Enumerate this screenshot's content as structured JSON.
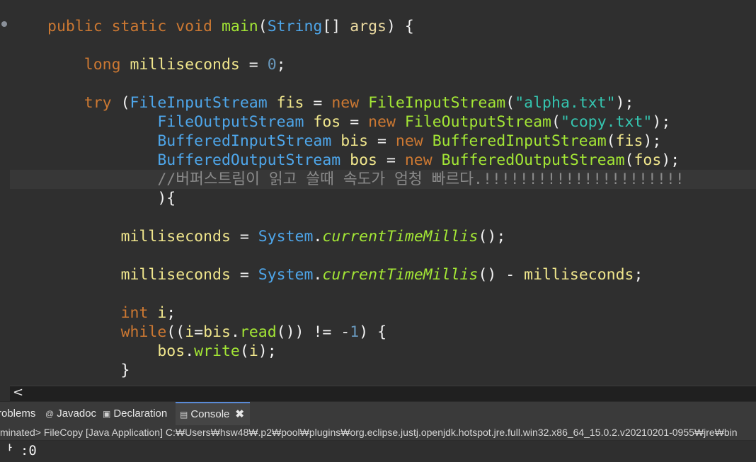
{
  "editor": {
    "lines": [
      [
        [
          "kw",
          "public "
        ],
        [
          "kw",
          "static "
        ],
        [
          "kw",
          "void "
        ],
        [
          "fn",
          "main"
        ],
        [
          "pl",
          "("
        ],
        [
          "ty",
          "String"
        ],
        [
          "pl",
          "[] "
        ],
        [
          "pa",
          "args"
        ],
        [
          "pl",
          ") {"
        ]
      ],
      [],
      [
        [
          "pl",
          "    "
        ],
        [
          "kw",
          "long "
        ],
        [
          "va",
          "milliseconds"
        ],
        [
          "pl",
          " = "
        ],
        [
          "nu",
          "0"
        ],
        [
          "pl",
          ";"
        ]
      ],
      [],
      [
        [
          "pl",
          "    "
        ],
        [
          "kw",
          "try "
        ],
        [
          "pl",
          "("
        ],
        [
          "ty",
          "FileInputStream "
        ],
        [
          "va",
          "fis"
        ],
        [
          "pl",
          " = "
        ],
        [
          "kw",
          "new "
        ],
        [
          "fn",
          "FileInputStream"
        ],
        [
          "pl",
          "("
        ],
        [
          "st",
          "\"alpha.txt\""
        ],
        [
          "pl",
          ");"
        ]
      ],
      [
        [
          "pl",
          "            "
        ],
        [
          "ty",
          "FileOutputStream "
        ],
        [
          "va",
          "fos"
        ],
        [
          "pl",
          " = "
        ],
        [
          "kw",
          "new "
        ],
        [
          "fn",
          "FileOutputStream"
        ],
        [
          "pl",
          "("
        ],
        [
          "st",
          "\"copy.txt\""
        ],
        [
          "pl",
          ");"
        ]
      ],
      [
        [
          "pl",
          "            "
        ],
        [
          "ty",
          "BufferedInputStream "
        ],
        [
          "va",
          "bis"
        ],
        [
          "pl",
          " = "
        ],
        [
          "kw",
          "new "
        ],
        [
          "fn",
          "BufferedInputStream"
        ],
        [
          "pl",
          "("
        ],
        [
          "va",
          "fis"
        ],
        [
          "pl",
          ");"
        ]
      ],
      [
        [
          "pl",
          "            "
        ],
        [
          "ty",
          "BufferedOutputStream "
        ],
        [
          "va",
          "bos"
        ],
        [
          "pl",
          " = "
        ],
        [
          "kw",
          "new "
        ],
        [
          "fn",
          "BufferedOutputStream"
        ],
        [
          "pl",
          "("
        ],
        [
          "va",
          "fos"
        ],
        [
          "pl",
          ");"
        ]
      ],
      [
        [
          "pl",
          "            "
        ],
        [
          "co",
          "//버퍼스트림이 읽고 쓸때 속도가 엄청 빠르다.!!!!!!!!!!!!!!!!!!!!!!"
        ]
      ],
      [
        [
          "pl",
          "            ){"
        ]
      ],
      [],
      [
        [
          "pl",
          "        "
        ],
        [
          "va",
          "milliseconds"
        ],
        [
          "pl",
          " = "
        ],
        [
          "ty",
          "System"
        ],
        [
          "pl",
          "."
        ],
        [
          "it",
          "currentTimeMillis"
        ],
        [
          "pl",
          "();"
        ]
      ],
      [],
      [
        [
          "pl",
          "        "
        ],
        [
          "va",
          "milliseconds"
        ],
        [
          "pl",
          " = "
        ],
        [
          "ty",
          "System"
        ],
        [
          "pl",
          "."
        ],
        [
          "it",
          "currentTimeMillis"
        ],
        [
          "pl",
          "() - "
        ],
        [
          "va",
          "milliseconds"
        ],
        [
          "pl",
          ";"
        ]
      ],
      [],
      [
        [
          "pl",
          "        "
        ],
        [
          "kw",
          "int "
        ],
        [
          "va",
          "i"
        ],
        [
          "pl",
          ";"
        ]
      ],
      [
        [
          "pl",
          "        "
        ],
        [
          "kw",
          "while"
        ],
        [
          "pl",
          "(("
        ],
        [
          "va",
          "i"
        ],
        [
          "pl",
          "="
        ],
        [
          "va",
          "bis"
        ],
        [
          "pl",
          "."
        ],
        [
          "me",
          "read"
        ],
        [
          "pl",
          "()) != -"
        ],
        [
          "nu",
          "1"
        ],
        [
          "pl",
          ") {"
        ]
      ],
      [
        [
          "pl",
          "            "
        ],
        [
          "va",
          "bos"
        ],
        [
          "pl",
          "."
        ],
        [
          "me",
          "write"
        ],
        [
          "pl",
          "("
        ],
        [
          "va",
          "i"
        ],
        [
          "pl",
          ");"
        ]
      ],
      [
        [
          "pl",
          "        }"
        ]
      ]
    ]
  },
  "scrollbar": {
    "left_arrow": "<"
  },
  "tabs": [
    {
      "label": "roblems",
      "icon": "problems-icon",
      "glyph": ""
    },
    {
      "label": "Javadoc",
      "icon": "javadoc-icon",
      "glyph": "@"
    },
    {
      "label": "Declaration",
      "icon": "declaration-icon",
      "glyph": "▣"
    },
    {
      "label": "Console",
      "icon": "console-icon",
      "glyph": "▤",
      "active": true,
      "close": "✖"
    }
  ],
  "console": {
    "header": "minated> FileCopy [Java Application] C:₩Users₩hsw48₩.p2₩pool₩plugins₩org.eclipse.justj.openjdk.hotspot.jre.full.win32.x86_64_15.0.2.v20210201-0955₩jre₩bin",
    "output": "ᅡ :0"
  }
}
